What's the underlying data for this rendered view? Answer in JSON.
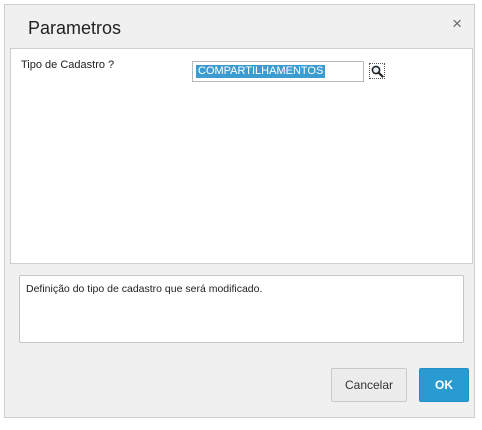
{
  "dialog": {
    "title": "Parametros",
    "close_glyph": "×",
    "close_icon": "close-icon"
  },
  "form": {
    "field_label": "Tipo de Cadastro ?",
    "field_value": "COMPARTILHAMENTOS",
    "lookup_icon": "search-icon"
  },
  "description": {
    "text": "Definição do tipo de cadastro que será modificado."
  },
  "buttons": {
    "cancel_label": "Cancelar",
    "ok_label": "OK"
  },
  "colors": {
    "accent": "#2a9bd1",
    "selection": "#3d9ccf"
  }
}
